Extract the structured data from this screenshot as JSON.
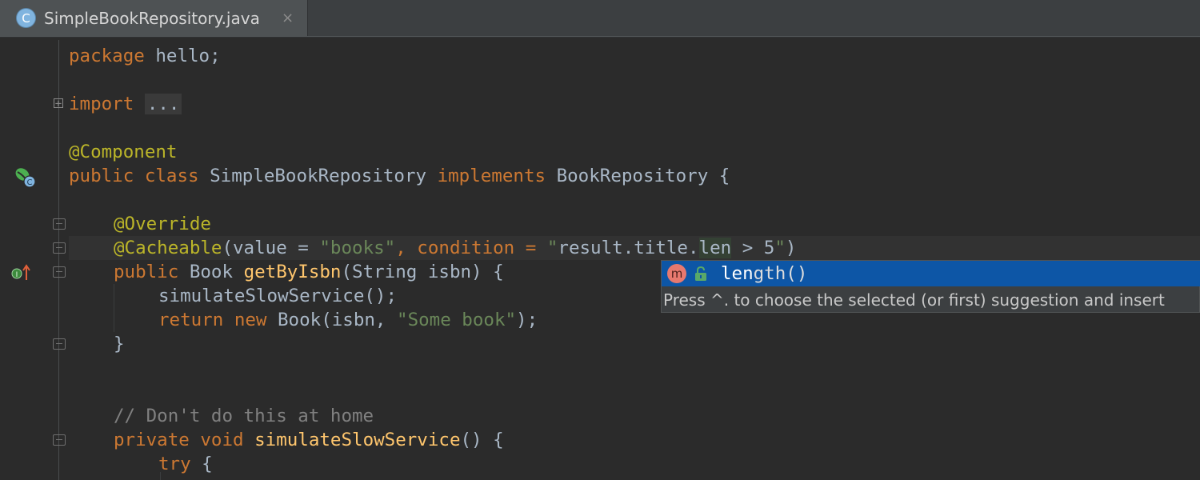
{
  "tab": {
    "icon_letter": "C",
    "title": "SimpleBookRepository.java",
    "close": "×"
  },
  "editor": {
    "lines": {
      "l1": [
        "package",
        " hello;"
      ],
      "l3": [
        "import",
        " ",
        "..."
      ],
      "l5": [
        "@Component"
      ],
      "l6": [
        "public class",
        " SimpleBookRepository ",
        "implements",
        " BookRepository {"
      ],
      "l8": [
        "@Override"
      ],
      "l9": [
        "@Cacheable",
        "(value = ",
        "\"books\"",
        ", condition = ",
        "\"",
        "result.title.",
        "len",
        " > 5",
        "\"",
        ")"
      ],
      "l10": [
        "public",
        " Book ",
        "getByIsbn",
        "(String isbn) {"
      ],
      "l11": [
        "simulateSlowService();"
      ],
      "l12": [
        "return new",
        " Book(isbn, ",
        "\"Some book\"",
        ");"
      ],
      "l13": [
        "}"
      ],
      "l16": [
        "// Don't do this at home"
      ],
      "l17": [
        "private void",
        " ",
        "simulateSlowService",
        "() {"
      ],
      "l18": [
        "try",
        " {"
      ]
    },
    "fold_plus": "+"
  },
  "completion": {
    "icon_letter": "m",
    "match": "len",
    "rest": "gth()",
    "hint": "Press ^. to choose the selected (or first) suggestion and insert"
  },
  "colors": {
    "background": "#2b2b2b",
    "keyword": "#cc7832",
    "annotation": "#bbb529",
    "string": "#6a8759",
    "method": "#ffc66d",
    "selection": "#0d56a6"
  }
}
